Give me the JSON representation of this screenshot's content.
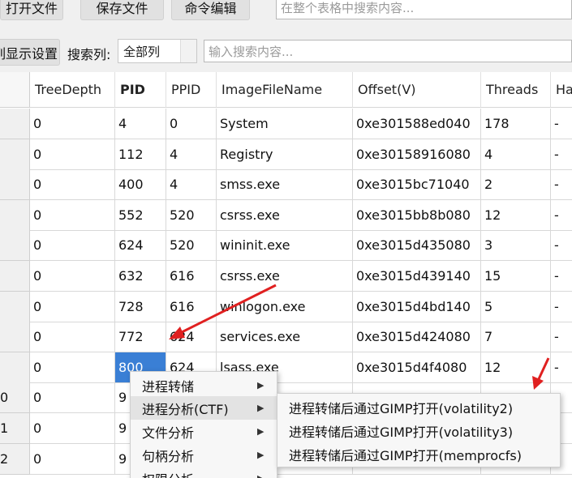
{
  "toolbar": {
    "open_label": "打开文件",
    "save_label": "保存文件",
    "cmd_label": "命令编辑",
    "global_search_placeholder": "在整个表格中搜索内容..."
  },
  "filterbar": {
    "display_settings_label": "列显示设置",
    "search_col_label": "搜索列:",
    "search_col_value": "全部列",
    "search_placeholder": "输入搜索内容..."
  },
  "table": {
    "columns": [
      "TreeDepth",
      "PID",
      "PPID",
      "ImageFileName",
      "Offset(V)",
      "Threads",
      "Ha"
    ],
    "rows": [
      {
        "row": "",
        "cells": [
          "0",
          "4",
          "0",
          "System",
          "0xe301588ed040",
          "178",
          "-"
        ]
      },
      {
        "row": "",
        "cells": [
          "0",
          "112",
          "4",
          "Registry",
          "0xe30158916080",
          "4",
          "-"
        ]
      },
      {
        "row": "",
        "cells": [
          "0",
          "400",
          "4",
          "smss.exe",
          "0xe3015bc71040",
          "2",
          "-"
        ]
      },
      {
        "row": "",
        "cells": [
          "0",
          "552",
          "520",
          "csrss.exe",
          "0xe3015bb8b080",
          "12",
          "-"
        ]
      },
      {
        "row": "",
        "cells": [
          "0",
          "624",
          "520",
          "wininit.exe",
          "0xe3015d435080",
          "3",
          "-"
        ]
      },
      {
        "row": "",
        "cells": [
          "0",
          "632",
          "616",
          "csrss.exe",
          "0xe3015d439140",
          "15",
          "-"
        ]
      },
      {
        "row": "",
        "cells": [
          "0",
          "728",
          "616",
          "winlogon.exe",
          "0xe3015d4bd140",
          "5",
          "-"
        ]
      },
      {
        "row": "",
        "cells": [
          "0",
          "772",
          "624",
          "services.exe",
          "0xe3015d424080",
          "7",
          "-"
        ]
      },
      {
        "row": "",
        "cells": [
          "0",
          "800",
          "624",
          "lsass.exe",
          "0xe3015d4f4080",
          "12",
          "-"
        ]
      },
      {
        "row": "0",
        "cells": [
          "0",
          "9",
          "",
          "",
          "",
          "",
          ""
        ]
      },
      {
        "row": "1",
        "cells": [
          "0",
          "9",
          "",
          "",
          "",
          "",
          ""
        ]
      },
      {
        "row": "2",
        "cells": [
          "0",
          "9",
          "",
          "",
          "",
          "",
          ""
        ]
      }
    ],
    "selected_value": "800"
  },
  "context_menu": {
    "items": [
      "进程转储",
      "进程分析(CTF)",
      "文件分析",
      "句柄分析",
      "权限分析"
    ],
    "submenu": [
      "进程转储后通过GIMP打开(volatility2)",
      "进程转储后通过GIMP打开(volatility3)",
      "进程转储后通过GIMP打开(memprocfs)"
    ]
  },
  "colors": {
    "selection": "#3a7fd5",
    "annotation_arrow": "#e02020"
  }
}
